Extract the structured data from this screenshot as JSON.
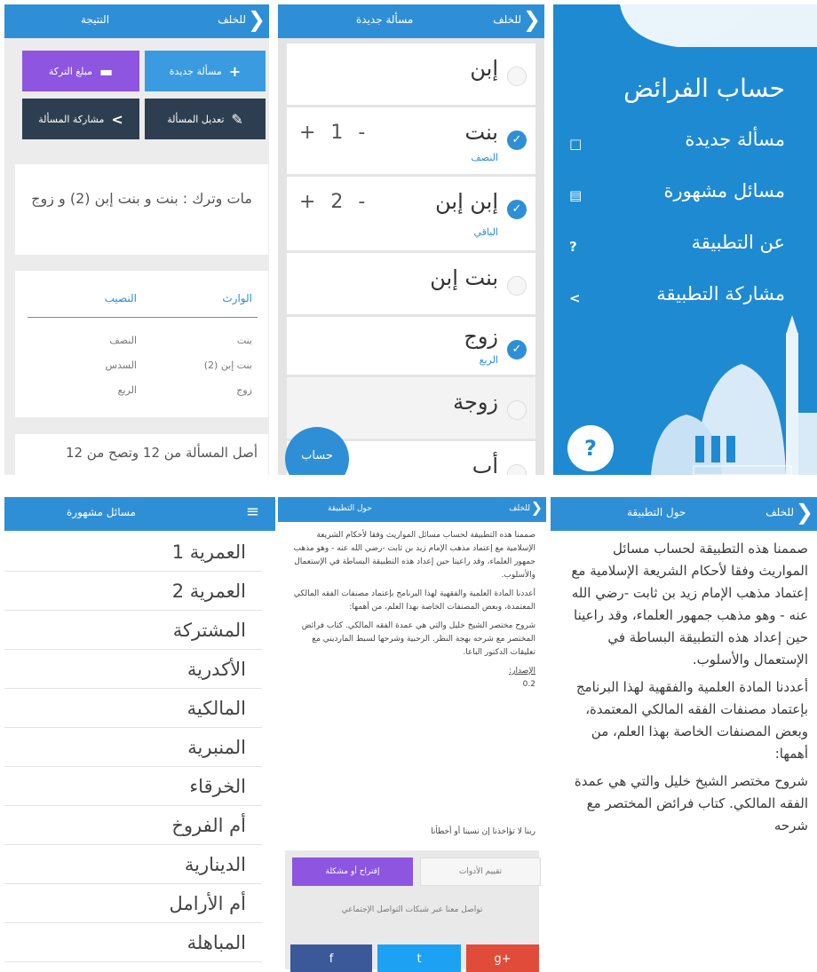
{
  "result_screen": {
    "header": {
      "title": "النتيجة",
      "back": "للخلف"
    },
    "buttons": {
      "new_problem": "مسألة جديدة",
      "estate_amount": "مبلغ التركة",
      "edit_problem": "تعديل المسألة",
      "share_problem": "مشاركة المسألة"
    },
    "summary": "مات وترك : بنت و بنت إبن (2) و زوج",
    "table": {
      "col_heir": "الوارث",
      "col_share": "النصيب",
      "rows": [
        {
          "heir": "بنت",
          "share": "النصف"
        },
        {
          "heir": "بنت إبن (2)",
          "share": "السدس"
        },
        {
          "heir": "زوج",
          "share": "الربع"
        }
      ]
    },
    "footer": "أصل المسألة من 12 وتصح من 12"
  },
  "new_problem_screen": {
    "header": {
      "title": "مسألة جديدة",
      "back": "للخلف"
    },
    "items": [
      {
        "label": "إبن",
        "sub": "",
        "checked": false,
        "count": ""
      },
      {
        "label": "بنت",
        "sub": "النصف",
        "checked": true,
        "count": "+ 1 -"
      },
      {
        "label": "إبن إبن",
        "sub": "الباقي",
        "checked": true,
        "count": "+ 2 -"
      },
      {
        "label": "بنت إبن",
        "sub": "",
        "checked": false,
        "count": ""
      },
      {
        "label": "زوج",
        "sub": "الربع",
        "checked": true,
        "count": ""
      },
      {
        "label": "زوجة",
        "sub": "",
        "checked": false,
        "count": ""
      },
      {
        "label": "أب",
        "sub": "",
        "checked": false,
        "count": ""
      }
    ],
    "calc_button": "حساب"
  },
  "home_screen": {
    "app_title": "حساب الفرائض",
    "menu": [
      {
        "label": "مسألة جديدة",
        "icon": "document-icon"
      },
      {
        "label": "مسائل مشهورة",
        "icon": "list-icon"
      },
      {
        "label": "عن التطبيقة",
        "icon": "question-icon"
      },
      {
        "label": "مشاركة التطبيقة",
        "icon": "share-icon"
      }
    ],
    "help_button": "?"
  },
  "famous_screen": {
    "header": {
      "title": "مسائل مشهورة"
    },
    "items": [
      "العمرية 1",
      "العمرية 2",
      "المشتركة",
      "الأكدرية",
      "المالكية",
      "المنبرية",
      "الخرقاء",
      "أم الفروخ",
      "الدينارية",
      "أم الأرامل",
      "المباهلة"
    ]
  },
  "about_small": {
    "header": {
      "title": "حول التطبيقة",
      "back": "للخلف"
    },
    "paragraphs": [
      "صممنا هذه التطبيقة لحساب مسائل المواريث وفقا لأحكام الشريعة الإسلامية مع إعتماد مذهب الإمام زيد بن ثابت -رضي الله عنه - وهو مذهب جمهور العلماء، وقد راعينا حين إعداد هذه التطبيقة البساطة في الإستعمال والأسلوب.",
      "أعددنا المادة العلمية والفقهية لهذا البرنامج بإعتماد مصنفات الفقه المالكي المعتمدة، وبعض المصنفات الخاصة بهذا العلم، من أهمها:",
      "شروح مختصر الشيخ خليل والتي هي عمدة الفقه المالكي. كتاب فرائض المختصر مع شرحه بهجة النظر. الرحبية وشرحها لسبط المارديني مع تعليقات الدكتور الباعا."
    ],
    "version_label": "الإصدار:",
    "version": "0.2",
    "prayer": "ربنا لا تؤاخذنا إن نسينا أو أخطأنا",
    "rate_button": "تقييم الأدوات",
    "report_button": "إقتراح أو مشكلة",
    "social_text": "تواصل معنا عبر شبكات التواصل الإجتماعي",
    "social": {
      "facebook": "f",
      "twitter": "t",
      "google": "g+"
    }
  },
  "about_large": {
    "header": {
      "title": "حول التطبيقة",
      "back": "للخلف"
    },
    "paragraphs": [
      "صممنا هذه التطبيقة لحساب مسائل المواريث وفقا لأحكام الشريعة الإسلامية مع إعتماد مذهب الإمام زيد بن ثابت -رضي الله عنه - وهو مذهب جمهور العلماء، وقد راعينا حين إعداد هذه التطبيقة البساطة في الإستعمال والأسلوب.",
      "أعددنا المادة العلمية والفقهية لهذا البرنامج بإعتماد مصنفات الفقه المالكي المعتمدة، وبعض المصنفات الخاصة بهذا العلم، من أهمها:",
      "شروح مختصر الشيخ خليل والتي هي عمدة الفقه المالكي. كتاب فرائض المختصر مع شرحه"
    ]
  },
  "colors": {
    "primary": "#2f8fd6",
    "purple": "#8d55e0",
    "dark": "#2d3e50",
    "red": "#e04b3a",
    "fb": "#3b5998",
    "tw": "#1da1f2"
  }
}
